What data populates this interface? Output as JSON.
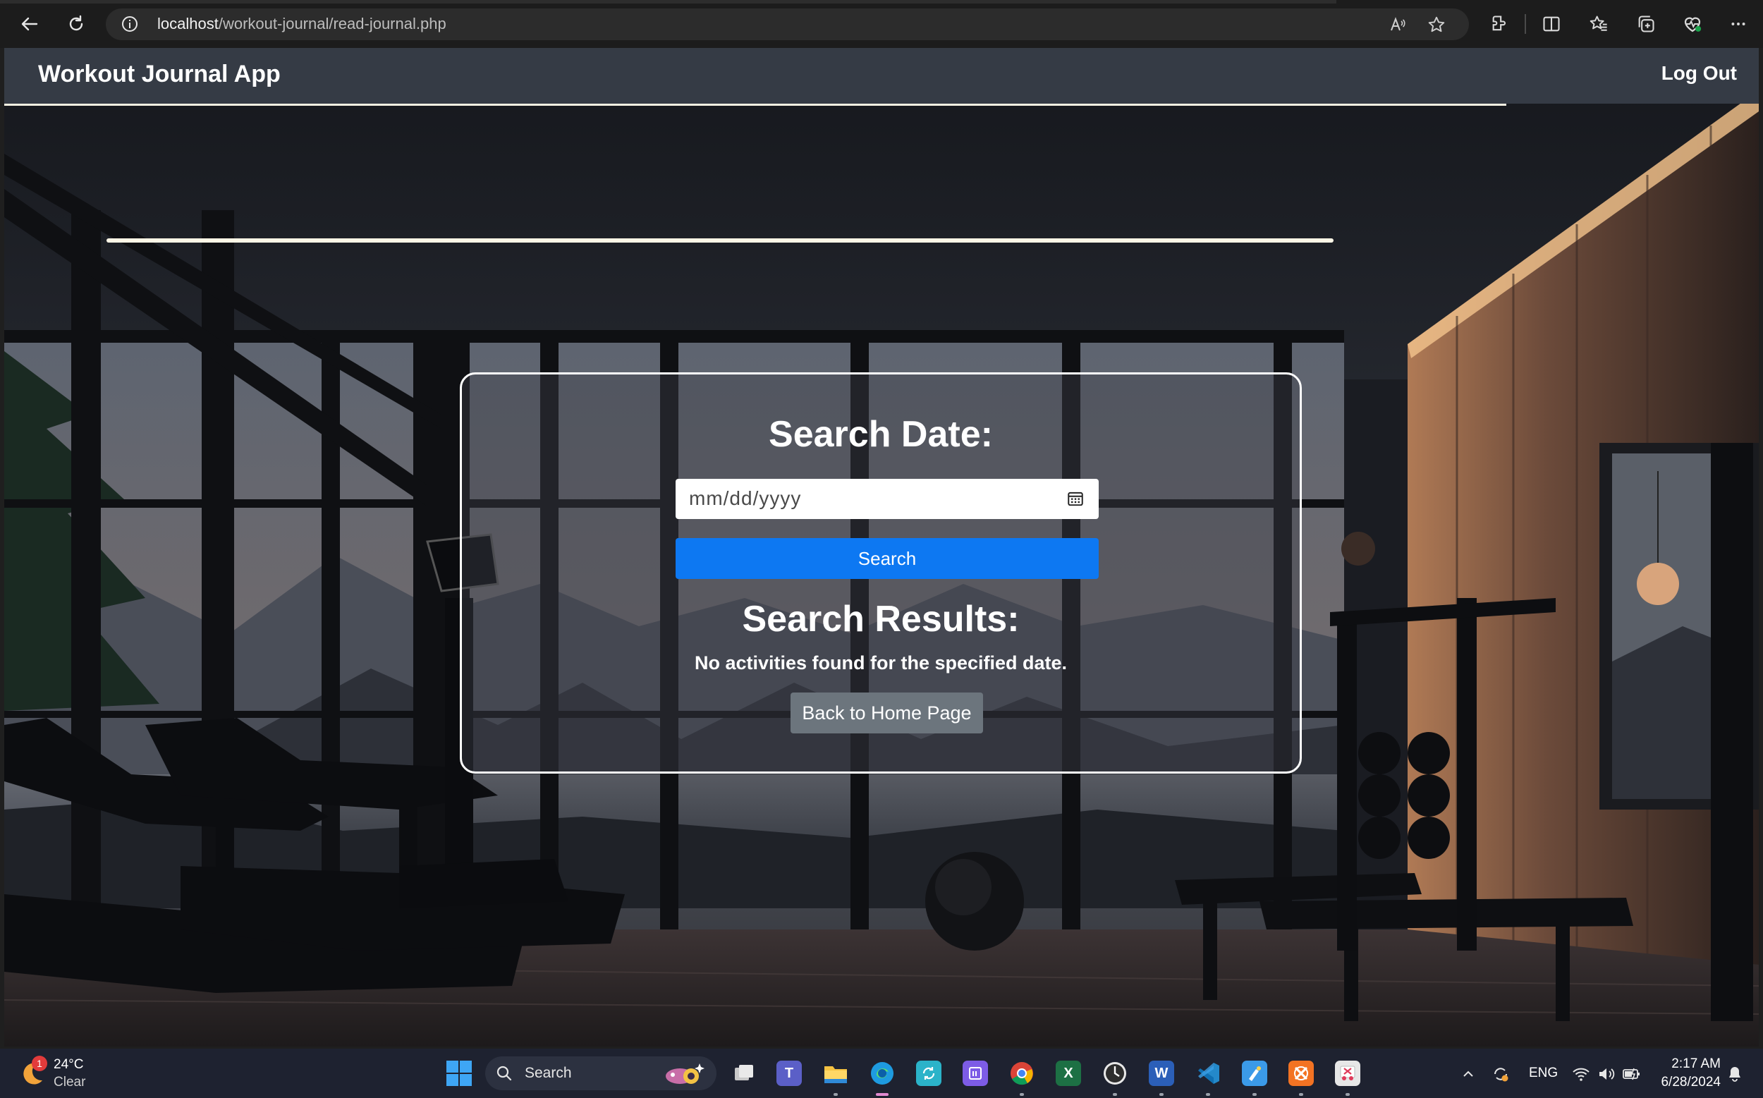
{
  "browser": {
    "url_host": "localhost",
    "url_path": "/workout-journal/read-journal.php",
    "icons": [
      "back-arrow-icon",
      "refresh-icon",
      "site-info-icon",
      "read-aloud-icon",
      "favorite-star-icon",
      "extensions-icon",
      "split-screen-icon",
      "favorites-icon",
      "collections-icon",
      "browser-essentials-icon",
      "more-icon"
    ]
  },
  "app": {
    "brand": "Workout Journal App",
    "logout_label": "Log Out",
    "navbar_color": "#353b45"
  },
  "search": {
    "title": "Search Date:",
    "date_placeholder": "mm/dd/yyyy",
    "search_button_label": "Search",
    "button_color": "#0d78f2"
  },
  "results": {
    "title": "Search Results:",
    "message": "No activities found for the specified date.",
    "home_button_label": "Back to Home Page",
    "home_button_color": "#6c757d"
  },
  "taskbar": {
    "weather_badge": "1",
    "weather_temp": "24°C",
    "weather_condition": "Clear",
    "search_label": "Search",
    "apps": [
      "file-viewer",
      "teams",
      "file-explorer",
      "edge",
      "sync-app",
      "notes-app",
      "chrome",
      "excel",
      "clock",
      "word",
      "vs-code",
      "paint",
      "xampp",
      "snipping-tool"
    ],
    "language": "ENG",
    "time": "2:17 AM",
    "date": "6/28/2024"
  }
}
